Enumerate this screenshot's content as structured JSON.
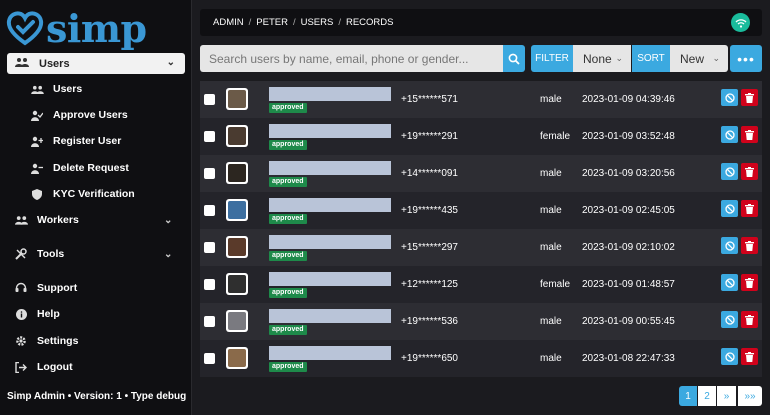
{
  "sidebar": {
    "logo_text": "simp",
    "active_item": "Users",
    "sub_items": [
      {
        "label": "Users",
        "icon": "users-icon"
      },
      {
        "label": "Approve Users",
        "icon": "user-check-icon"
      },
      {
        "label": "Register User",
        "icon": "user-plus-icon"
      },
      {
        "label": "Delete Request",
        "icon": "user-minus-icon"
      },
      {
        "label": "KYC Verification",
        "icon": "shield-icon"
      }
    ],
    "groups": [
      {
        "label": "Workers",
        "icon": "workers-icon"
      },
      {
        "label": "Tools",
        "icon": "tools-icon"
      }
    ],
    "bottom_items": [
      {
        "label": "Support",
        "icon": "headset-icon"
      },
      {
        "label": "Help",
        "icon": "info-icon"
      },
      {
        "label": "Settings",
        "icon": "gear-icon"
      },
      {
        "label": "Logout",
        "icon": "logout-icon"
      }
    ],
    "footer": "Simp Admin • Version: 1 • Type debug"
  },
  "header": {
    "breadcrumb": [
      "ADMIN",
      "PETER",
      "USERS",
      "RECORDS"
    ],
    "status_icon": "wifi-icon",
    "status_color": "#1abc9c"
  },
  "toolbar": {
    "search_placeholder": "Search users by name, email, phone or gender...",
    "filter_label": "FILTER",
    "filter_value": "None",
    "sort_label": "SORT",
    "sort_value": "New",
    "more_label": "•••",
    "accent": "#3ba9e0"
  },
  "rows": [
    {
      "status": "approved",
      "phone": "+15******571",
      "gender": "male",
      "date": "2023-01-09 04:39:46"
    },
    {
      "status": "approved",
      "phone": "+19******291",
      "gender": "female",
      "date": "2023-01-09 03:52:48"
    },
    {
      "status": "approved",
      "phone": "+14******091",
      "gender": "male",
      "date": "2023-01-09 03:20:56"
    },
    {
      "status": "approved",
      "phone": "+19******435",
      "gender": "male",
      "date": "2023-01-09 02:45:05"
    },
    {
      "status": "approved",
      "phone": "+15******297",
      "gender": "male",
      "date": "2023-01-09 02:10:02"
    },
    {
      "status": "approved",
      "phone": "+12******125",
      "gender": "female",
      "date": "2023-01-09 01:48:57"
    },
    {
      "status": "approved",
      "phone": "+19******536",
      "gender": "male",
      "date": "2023-01-09 00:55:45"
    },
    {
      "status": "approved",
      "phone": "+19******650",
      "gender": "male",
      "date": "2023-01-08 22:47:33"
    }
  ],
  "pagination": [
    "1",
    "2",
    "»",
    "»»"
  ],
  "current_page": "1"
}
